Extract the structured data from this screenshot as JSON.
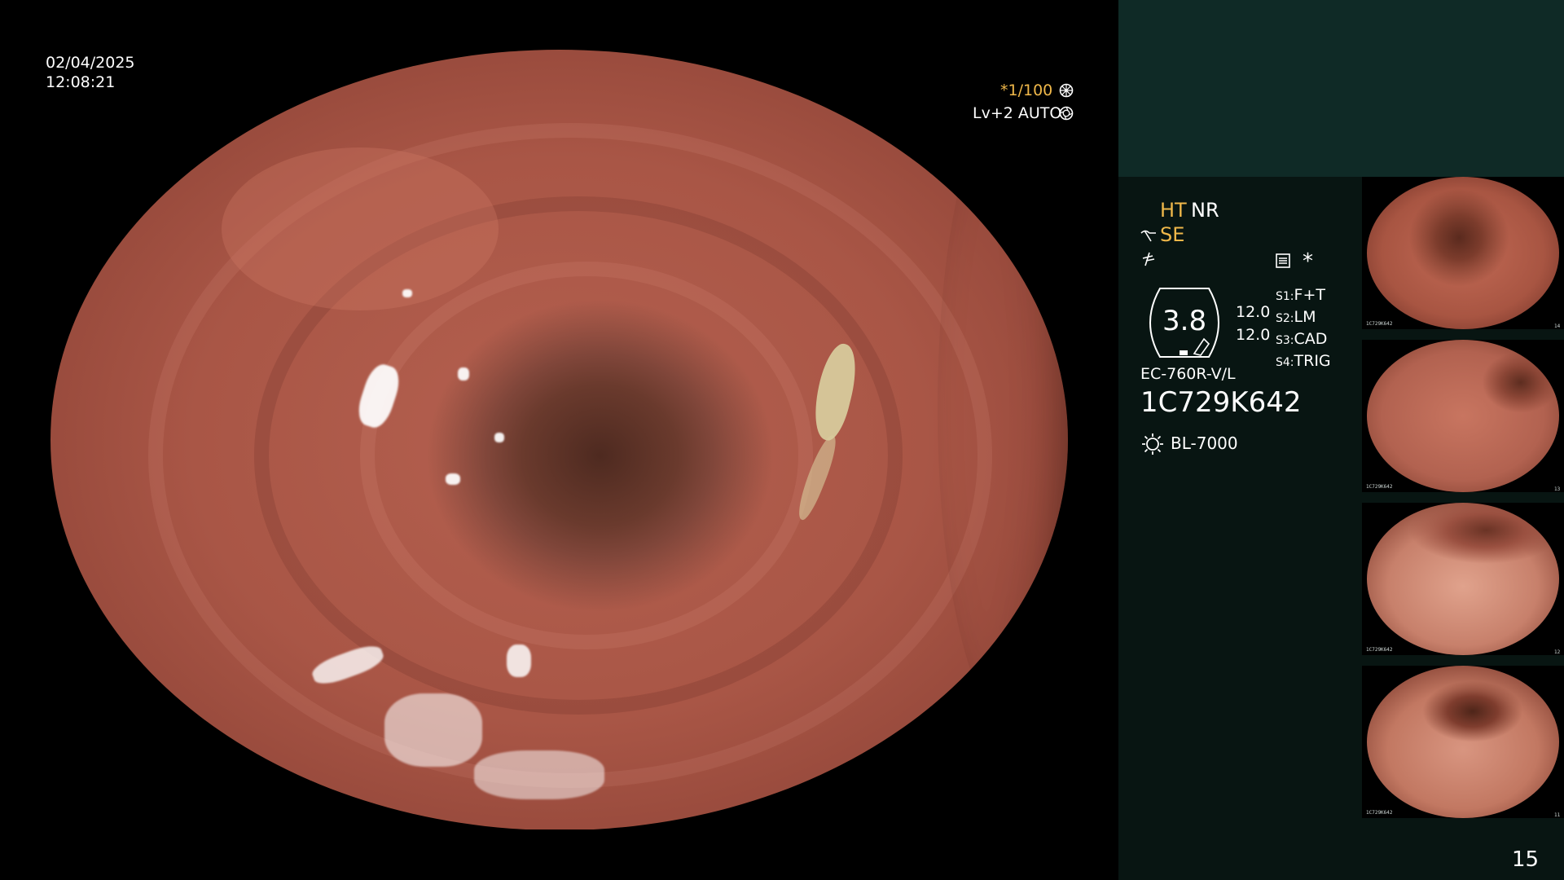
{
  "live_view": {
    "date": "02/04/2025",
    "time": "12:08:21",
    "shutter": "*1/100",
    "shutter_icon": "shutter-icon",
    "iris": "Lv+2 AUTO",
    "iris_icon": "iris-icon"
  },
  "panel": {
    "enhancement_label": "HT",
    "noise_reduction_label": "NR",
    "structure_label": "SE",
    "gauge_value": "3.8",
    "gauge_top_value": "12.0",
    "gauge_bottom_value": "12.0",
    "switches": [
      {
        "key": "S1",
        "value": "F+T"
      },
      {
        "key": "S2",
        "value": "LM"
      },
      {
        "key": "S3",
        "value": "CAD"
      },
      {
        "key": "S4",
        "value": "TRIG"
      }
    ],
    "asterisk": "*",
    "scope_model": "EC-760R-V/L",
    "scope_serial": "1C729K642",
    "light_source": "BL-7000",
    "frame_number": "15",
    "colors": {
      "panel_header": "#0f2a26",
      "panel_body": "#081512",
      "accent_orange": "#f0b84a"
    }
  },
  "thumbnails": [
    {
      "index": "14",
      "serial": "1C729K642"
    },
    {
      "index": "13",
      "serial": "1C729K642"
    },
    {
      "index": "12",
      "serial": "1C729K642"
    },
    {
      "index": "11",
      "serial": "1C729K642"
    }
  ]
}
